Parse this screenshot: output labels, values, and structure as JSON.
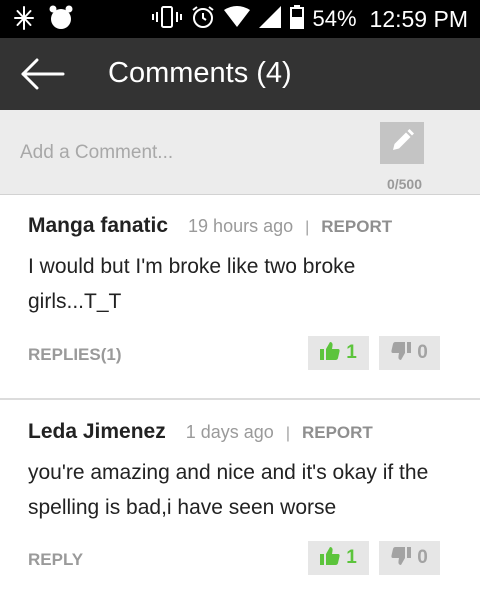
{
  "status_bar": {
    "battery": "54%",
    "time": "12:59 PM"
  },
  "header": {
    "title": "Comments (4)"
  },
  "add_comment": {
    "placeholder": "Add a Comment...",
    "counter": "0/500"
  },
  "comments": [
    {
      "author": "Manga fanatic",
      "time": "19 hours ago",
      "separator": "|",
      "report_label": "REPORT",
      "text": "I would but I'm broke like two broke girls...T_T",
      "replies_label": "REPLIES(1)",
      "upvotes": "1",
      "downvotes": "0"
    },
    {
      "author": "Leda Jimenez",
      "time": "1 days ago",
      "separator": "|",
      "report_label": "REPORT",
      "text": "you're amazing and nice and it's okay if the spelling is bad,i have seen worse",
      "replies_label": "REPLY",
      "upvotes": "1",
      "downvotes": "0"
    }
  ],
  "colors": {
    "status_bar": "#000000",
    "app_bar": "#333333",
    "upvote": "#5cc43c",
    "downvote": "#a3a3a3"
  }
}
